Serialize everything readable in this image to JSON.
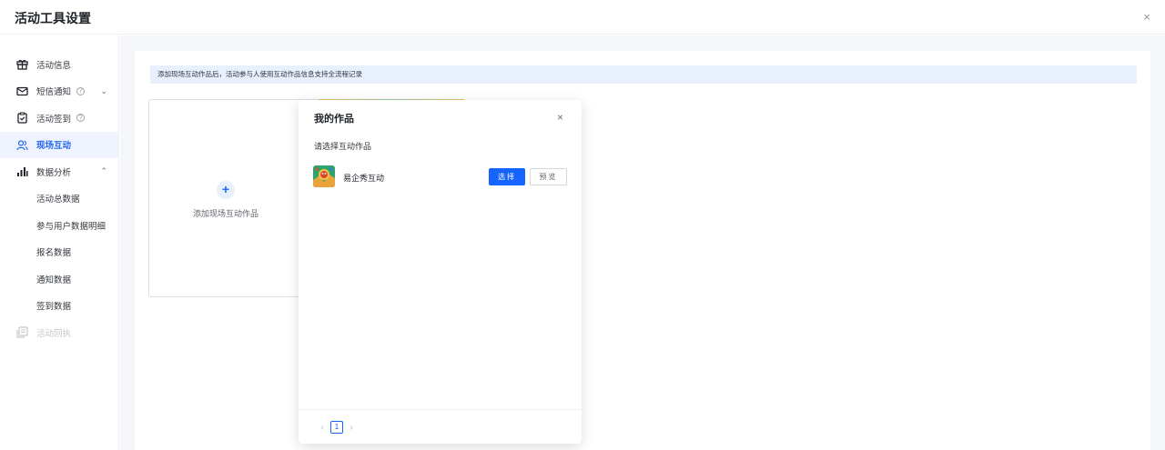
{
  "window": {
    "title": "活动工具设置",
    "close_glyph": "×"
  },
  "sidebar": {
    "items": [
      {
        "label": "活动信息",
        "icon": "gift-icon"
      },
      {
        "label": "短信通知",
        "icon": "mail-icon",
        "help": "?",
        "caret": "⌄"
      },
      {
        "label": "活动签到",
        "icon": "checkin-icon",
        "help": "?"
      },
      {
        "label": "现场互动",
        "icon": "users-icon",
        "active": true
      },
      {
        "label": "数据分析",
        "icon": "bar-chart-icon",
        "caret": "⌃"
      },
      {
        "label": "活动回执",
        "icon": "receipt-icon",
        "disabled": true
      }
    ],
    "sub_items": [
      "活动总数据",
      "参与用户数据明细",
      "报名数据",
      "通知数据",
      "签到数据"
    ]
  },
  "main": {
    "notice": "添加现场互动作品后，活动参与人使用互动作品信息支持全流程记录",
    "add_card": {
      "plus": "+",
      "label": "添加现场互动作品"
    }
  },
  "modal": {
    "title": "我的作品",
    "close_glyph": "×",
    "subtitle": "请选择互动作品",
    "works": [
      {
        "name": "易企秀互动",
        "select_label": "选择",
        "preview_label": "预览"
      }
    ],
    "pagination": {
      "prev": "‹",
      "current": "1",
      "next": "›"
    }
  },
  "colors": {
    "primary": "#1664ff",
    "active_bg": "#eef3ff",
    "notice_bg": "#e8effd",
    "page_bg": "#f4f6f9"
  }
}
